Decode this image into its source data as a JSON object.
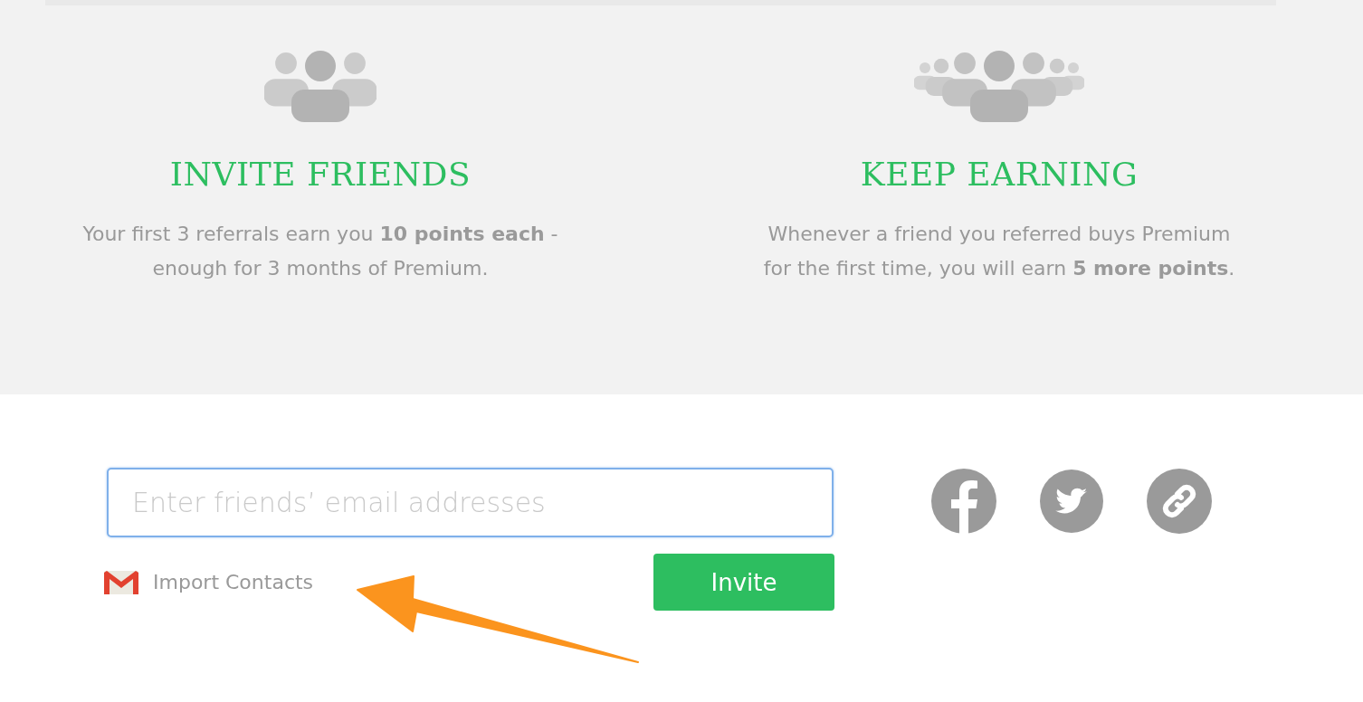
{
  "features": [
    {
      "kind": "small-group",
      "title": "INVITE FRIENDS",
      "text": "Your first 3 referrals earn you **10 points each** - enough for 3 months of Premium."
    },
    {
      "kind": "large-group",
      "title": "KEEP EARNING",
      "text": "Whenever a friend you referred buys Premium for the first time, you will earn **5 more points**."
    }
  ],
  "invite_form": {
    "placeholder": "Enter friends’ email addresses",
    "import_link": "Import Contacts",
    "button": "Invite"
  },
  "share_buttons": [
    {
      "kind": "facebook"
    },
    {
      "kind": "twitter"
    },
    {
      "kind": "link"
    }
  ]
}
